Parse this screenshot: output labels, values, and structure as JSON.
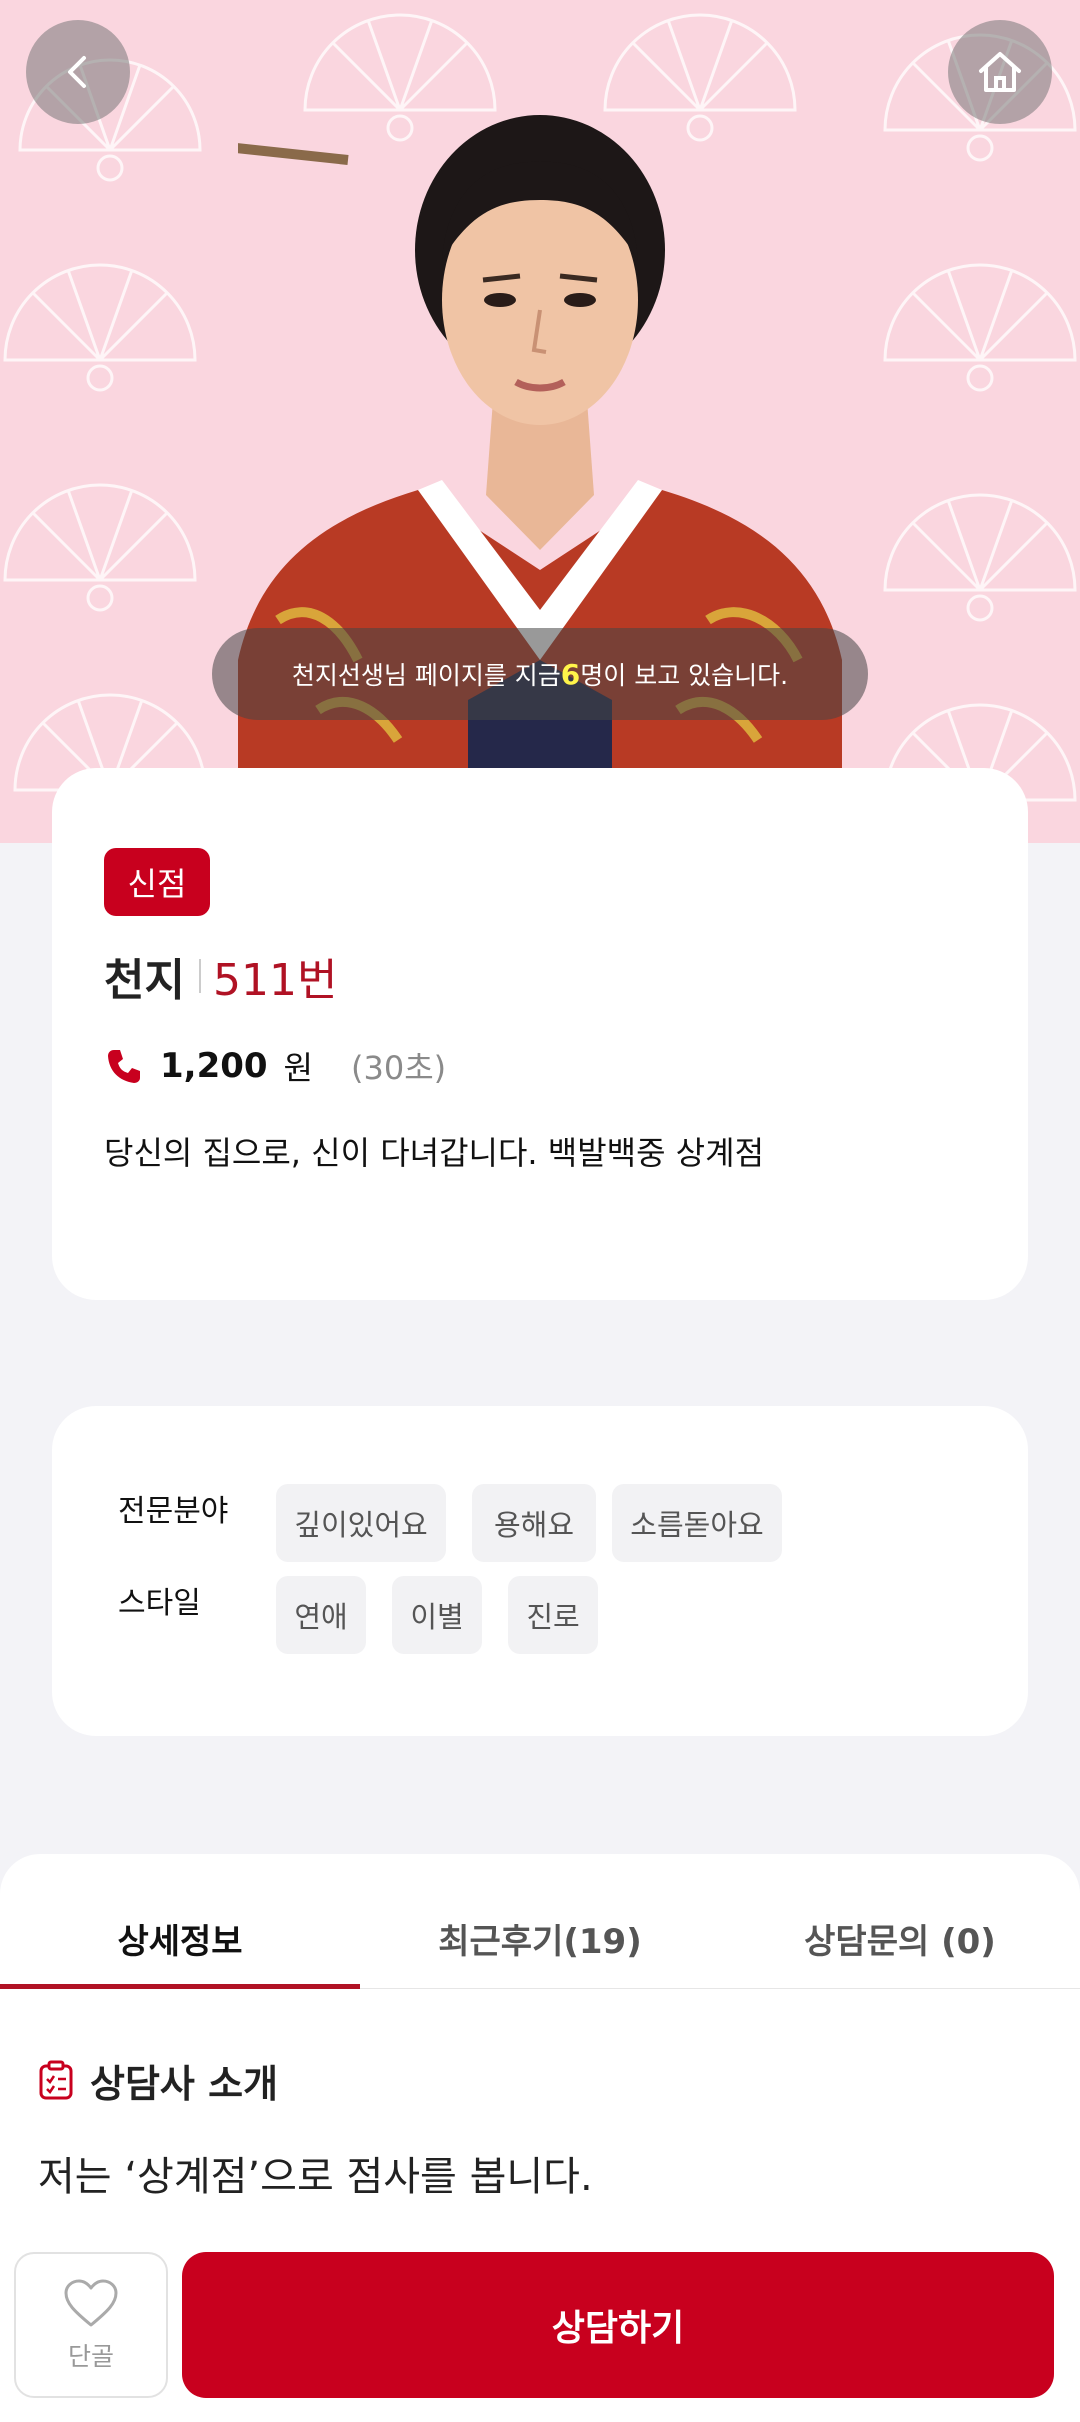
{
  "hero": {
    "viewer_text_before": "천지선생님 페이지를 지금 ",
    "viewer_count": "6",
    "viewer_text_after": "명이 보고 있습니다."
  },
  "profile": {
    "badge": "신점",
    "name": "천지",
    "number": "511번",
    "price": "1,200",
    "currency": "원",
    "per_unit": "(30초)",
    "tagline": "당신의 집으로, 신이 다녀갑니다. 백발백중 상계점"
  },
  "specialty": {
    "label": "전문분야",
    "chips": [
      "깊이있어요",
      "용해요",
      "소름돋아요"
    ]
  },
  "style": {
    "label": "스타일",
    "chips": [
      "연애",
      "이별",
      "진로"
    ]
  },
  "tabs": [
    {
      "label": "상세정보"
    },
    {
      "label": "최근후기(19)"
    },
    {
      "label": "상담문의 (0)"
    }
  ],
  "section": {
    "title": "상담사 소개",
    "intro": "저는 ‘상계점’으로 점사를 봅니다."
  },
  "bottom": {
    "fav_label": "단골",
    "consult_label": "상담하기"
  },
  "colors": {
    "accent": "#c8001e",
    "hero_bg": "#fad6df",
    "highlight": "#fff44a"
  }
}
